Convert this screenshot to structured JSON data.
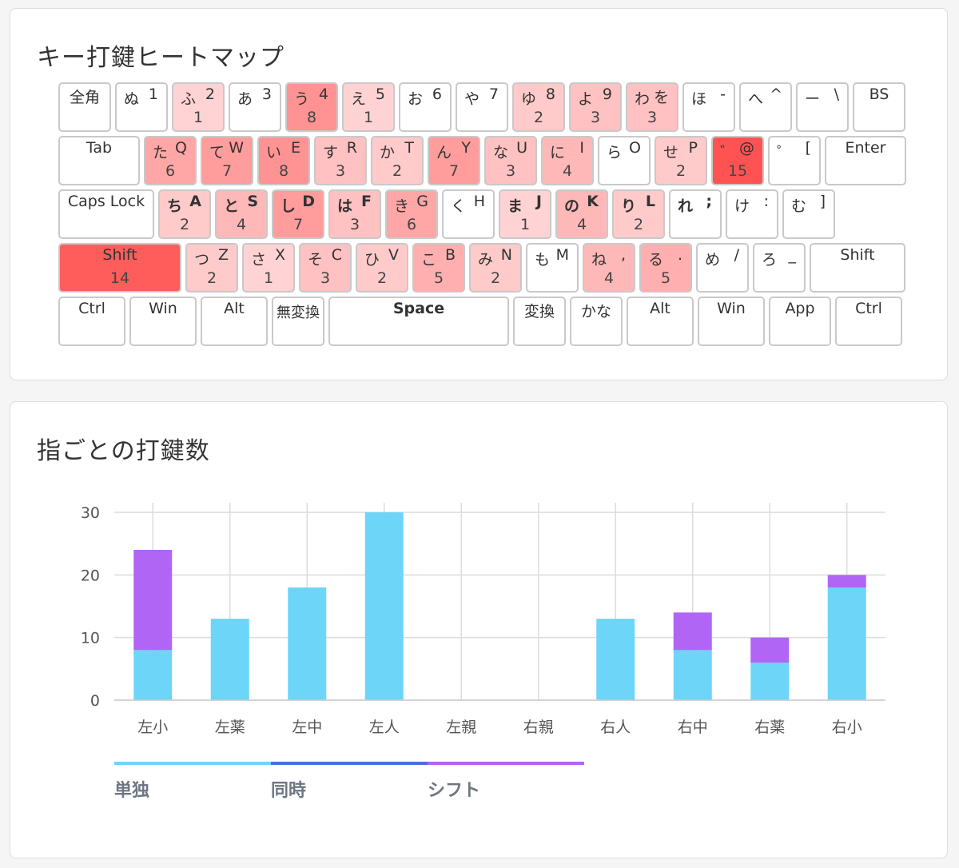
{
  "heatmap": {
    "title": "キー打鍵ヒートマップ",
    "max_count": 15,
    "rows": [
      [
        {
          "id": "zenkaku",
          "single": "全角",
          "w": 66
        },
        {
          "id": "1",
          "kana": "ぬ",
          "latin": "1",
          "w": 66
        },
        {
          "id": "2",
          "kana": "ふ",
          "latin": "2",
          "count": 1,
          "w": 66
        },
        {
          "id": "3",
          "kana": "あ",
          "latin": "3",
          "w": 66
        },
        {
          "id": "4",
          "kana": "う",
          "latin": "4",
          "count": 8,
          "w": 66
        },
        {
          "id": "5",
          "kana": "え",
          "latin": "5",
          "count": 1,
          "w": 66
        },
        {
          "id": "6",
          "kana": "お",
          "latin": "6",
          "w": 66
        },
        {
          "id": "7",
          "kana": "や",
          "latin": "7",
          "w": 66
        },
        {
          "id": "8",
          "kana": "ゆ",
          "latin": "8",
          "count": 2,
          "w": 66
        },
        {
          "id": "9",
          "kana": "よ",
          "latin": "9",
          "count": 3,
          "w": 66
        },
        {
          "id": "0",
          "kana": "わ",
          "latin": "を",
          "count": 3,
          "w": 66
        },
        {
          "id": "minus",
          "kana": "ほ",
          "latin": "-",
          "w": 66
        },
        {
          "id": "caret",
          "kana": "へ",
          "latin": "^",
          "w": 66
        },
        {
          "id": "yen",
          "kana": "ー",
          "latin": "\\",
          "w": 66
        },
        {
          "id": "bs",
          "single": "BS",
          "w": 66
        }
      ],
      [
        {
          "id": "tab",
          "single": "Tab",
          "w": 102
        },
        {
          "id": "q",
          "kana": "た",
          "latin": "Q",
          "count": 6,
          "w": 66
        },
        {
          "id": "w",
          "kana": "て",
          "latin": "W",
          "count": 7,
          "w": 66
        },
        {
          "id": "e",
          "kana": "い",
          "latin": "E",
          "count": 8,
          "w": 66
        },
        {
          "id": "r",
          "kana": "す",
          "latin": "R",
          "count": 3,
          "w": 66
        },
        {
          "id": "t",
          "kana": "か",
          "latin": "T",
          "count": 2,
          "w": 66
        },
        {
          "id": "y",
          "kana": "ん",
          "latin": "Y",
          "count": 7,
          "w": 66
        },
        {
          "id": "u",
          "kana": "な",
          "latin": "U",
          "count": 3,
          "w": 66
        },
        {
          "id": "i",
          "kana": "に",
          "latin": "I",
          "count": 4,
          "w": 66
        },
        {
          "id": "o",
          "kana": "ら",
          "latin": "O",
          "w": 66
        },
        {
          "id": "p",
          "kana": "せ",
          "latin": "P",
          "count": 2,
          "w": 66
        },
        {
          "id": "at",
          "kana": "゛",
          "latin": "@",
          "count": 15,
          "w": 66
        },
        {
          "id": "bracket",
          "kana": "゜",
          "latin": "[",
          "w": 66
        },
        {
          "id": "enter",
          "single": "Enter",
          "w": 102
        }
      ],
      [
        {
          "id": "caps",
          "single": "Caps Lock",
          "w": 120
        },
        {
          "id": "a",
          "kana": "ち",
          "latin": "A",
          "count": 2,
          "w": 66,
          "bold": true
        },
        {
          "id": "s",
          "kana": "と",
          "latin": "S",
          "count": 4,
          "w": 66,
          "bold": true
        },
        {
          "id": "d",
          "kana": "し",
          "latin": "D",
          "count": 7,
          "w": 66,
          "bold": true
        },
        {
          "id": "f",
          "kana": "は",
          "latin": "F",
          "count": 3,
          "w": 66,
          "bold": true
        },
        {
          "id": "g",
          "kana": "き",
          "latin": "G",
          "count": 6,
          "w": 66
        },
        {
          "id": "h",
          "kana": "く",
          "latin": "H",
          "w": 66
        },
        {
          "id": "j",
          "kana": "ま",
          "latin": "J",
          "count": 1,
          "w": 66,
          "bold": true
        },
        {
          "id": "k",
          "kana": "の",
          "latin": "K",
          "count": 4,
          "w": 66,
          "bold": true
        },
        {
          "id": "l",
          "kana": "り",
          "latin": "L",
          "count": 2,
          "w": 66,
          "bold": true
        },
        {
          "id": "semicolon",
          "kana": "れ",
          "latin": ";",
          "w": 66,
          "bold": true
        },
        {
          "id": "colon",
          "kana": "け",
          "latin": ":",
          "w": 66
        },
        {
          "id": "rbracket",
          "kana": "む",
          "latin": "]",
          "w": 66
        }
      ],
      [
        {
          "id": "lshift",
          "single": "Shift",
          "count": 14,
          "w": 154
        },
        {
          "id": "z",
          "kana": "つ",
          "latin": "Z",
          "count": 2,
          "w": 66
        },
        {
          "id": "x",
          "kana": "さ",
          "latin": "X",
          "count": 1,
          "w": 66
        },
        {
          "id": "c",
          "kana": "そ",
          "latin": "C",
          "count": 3,
          "w": 66
        },
        {
          "id": "v",
          "kana": "ひ",
          "latin": "V",
          "count": 2,
          "w": 66
        },
        {
          "id": "b",
          "kana": "こ",
          "latin": "B",
          "count": 5,
          "w": 66
        },
        {
          "id": "n",
          "kana": "み",
          "latin": "N",
          "count": 2,
          "w": 66
        },
        {
          "id": "m",
          "kana": "も",
          "latin": "M",
          "w": 66
        },
        {
          "id": "comma",
          "kana": "ね",
          "latin": ",",
          "count": 4,
          "w": 66
        },
        {
          "id": "period",
          "kana": "る",
          "latin": ".",
          "count": 5,
          "w": 66
        },
        {
          "id": "slash",
          "kana": "め",
          "latin": "/",
          "w": 66
        },
        {
          "id": "backslash",
          "kana": "ろ",
          "latin": "_",
          "w": 66
        },
        {
          "id": "rshift",
          "single": "Shift",
          "w": 120
        }
      ],
      [
        {
          "id": "lctrl",
          "single": "Ctrl",
          "w": 84
        },
        {
          "id": "lwin",
          "single": "Win",
          "w": 84
        },
        {
          "id": "lalt",
          "single": "Alt",
          "w": 84
        },
        {
          "id": "muhenkan",
          "single": "無変換",
          "w": 66,
          "small": true
        },
        {
          "id": "space",
          "single": "Space",
          "w": 226,
          "bold": true
        },
        {
          "id": "henkan",
          "single": "変換",
          "w": 66
        },
        {
          "id": "kana",
          "single": "かな",
          "w": 66
        },
        {
          "id": "ralt",
          "single": "Alt",
          "w": 84
        },
        {
          "id": "rwin",
          "single": "Win",
          "w": 84
        },
        {
          "id": "app",
          "single": "App",
          "w": 78
        },
        {
          "id": "rctrl",
          "single": "Ctrl",
          "w": 84
        }
      ]
    ]
  },
  "fingers": {
    "title": "指ごとの打鍵数",
    "colors": {
      "single": "#6dd5f7",
      "simultaneous": "#4c6ee5",
      "shift": "#b165f5"
    },
    "legend": [
      {
        "key": "single",
        "label": "単独"
      },
      {
        "key": "simultaneous",
        "label": "同時"
      },
      {
        "key": "shift",
        "label": "シフト"
      }
    ],
    "chart_data": {
      "type": "bar",
      "stacked": true,
      "categories": [
        "左小",
        "左薬",
        "左中",
        "左人",
        "左親",
        "右親",
        "右人",
        "右中",
        "右薬",
        "右小"
      ],
      "series": [
        {
          "name": "単独",
          "key": "single",
          "values": [
            8,
            13,
            18,
            30,
            0,
            0,
            13,
            8,
            6,
            18
          ]
        },
        {
          "name": "同時",
          "key": "simultaneous",
          "values": [
            0,
            0,
            0,
            0,
            0,
            0,
            0,
            0,
            0,
            0
          ]
        },
        {
          "name": "シフト",
          "key": "shift",
          "values": [
            16,
            0,
            0,
            0,
            0,
            0,
            0,
            6,
            4,
            2
          ]
        }
      ],
      "yticks": [
        0,
        10,
        20,
        30
      ],
      "ylim": [
        0,
        30
      ],
      "grid": true,
      "legend_position": "bottom"
    }
  }
}
